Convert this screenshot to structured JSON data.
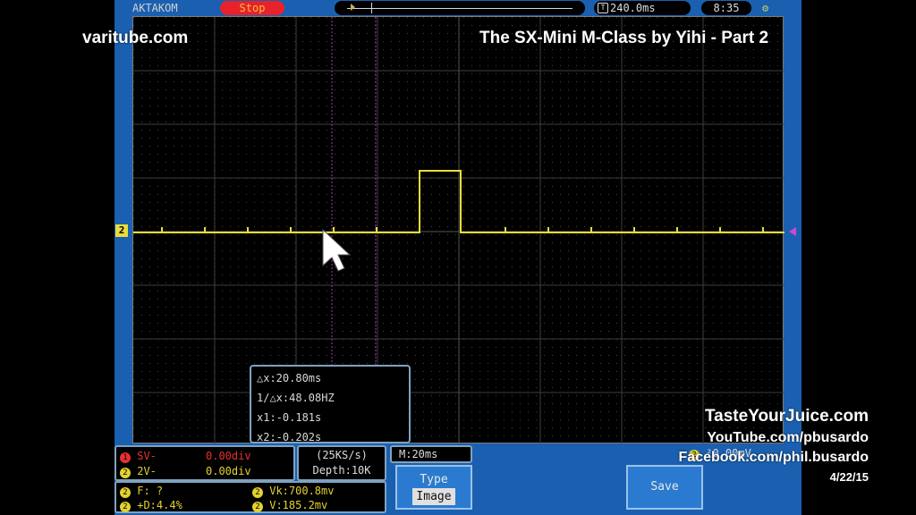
{
  "overlay": {
    "site": "varitube.com",
    "title": "The SX-Mini M-Class by Yihi - Part 2",
    "credit_site": "TasteYourJuice.com",
    "youtube": "YouTube.com/pbusardo",
    "facebook": "Facebook.com/phil.busardo",
    "date": "4/22/15"
  },
  "scope": {
    "brand": "AKTAKOM",
    "run_state": "Stop",
    "trigger_marker": "T",
    "time_position": "240.0ms",
    "clock": "8:35",
    "channel_marker": "2"
  },
  "cursor_readout": {
    "dx": "△x:20.80ms",
    "inv_dx": "1/△x:48.08HZ",
    "x1": "x1:-0.181s",
    "x2": "x2:-0.202s"
  },
  "bottom": {
    "ch_sv_label": "SV-",
    "ch_sv_value": "0.00div",
    "ch_2v_label": "2V-",
    "ch_2v_value": "0.00div",
    "freq": "F:  ?",
    "vpk": "Vk:700.8mv",
    "duty": "+D:4.4%",
    "vrms": "V:185.2mv",
    "sample_rate": "(25KS/s)",
    "depth": "Depth:10K",
    "timebase": "M:20ms",
    "type_label": "Type",
    "type_value": "Image",
    "save_label": "Save",
    "trigger_info_partial": "²0.00mV"
  },
  "colors": {
    "trace": "#e9dd3a",
    "cursor_lines": "#a23ac0",
    "trigger_marker": "#c94ad8",
    "frame": "#1b60b0"
  }
}
